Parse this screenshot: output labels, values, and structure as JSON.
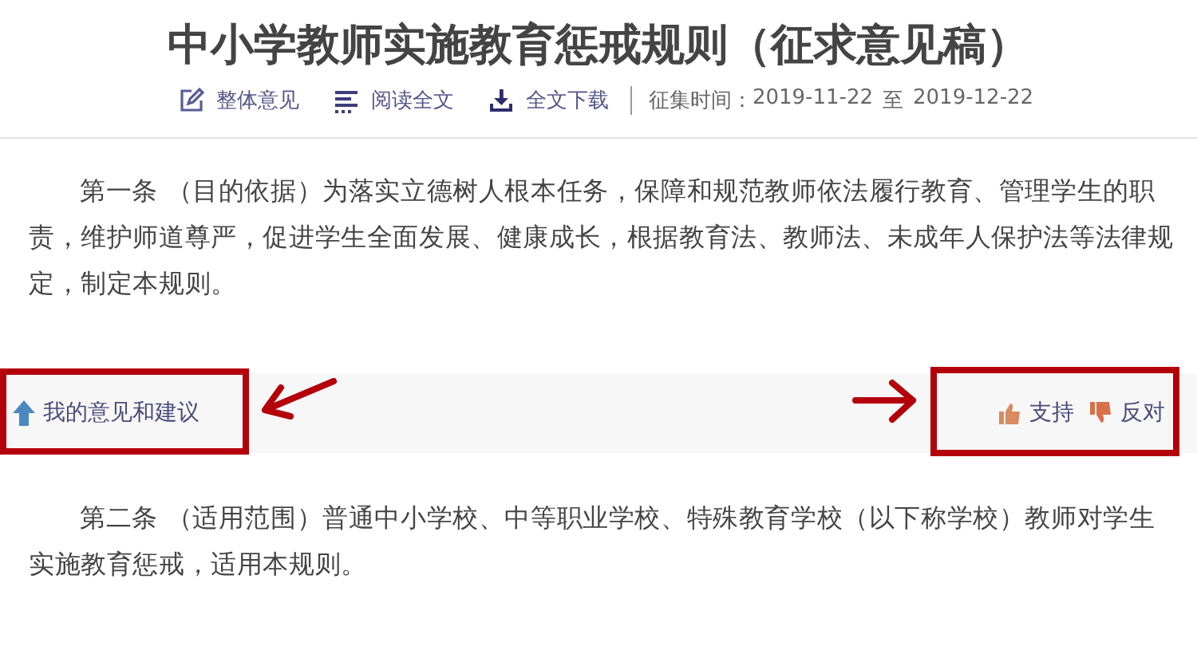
{
  "title": "中小学教师实施教育惩戒规则（征求意见稿）",
  "toolbar": [
    {
      "kind": "edit",
      "label": "整体意见"
    },
    {
      "kind": "read",
      "label": "阅读全文"
    },
    {
      "kind": "download",
      "label": "全文下载"
    }
  ],
  "period": {
    "label": "征集时间：",
    "start": "2019-11-22",
    "separator": "至",
    "end": "2019-12-22"
  },
  "articles": [
    {
      "text": "第一条 （目的依据）为落实立德树人根本任务，保障和规范教师依法履行教育、管理学生的职责，维护师道尊严，促进学生全面发展、健康成长，根据教育法、教师法、未成年人保护法等法律规定，制定本规则。"
    },
    {
      "text": "第二条 （适用范围）普通中小学校、中等职业学校、特殊教育学校（以下称学校）教师对学生实施教育惩戒，适用本规则。"
    }
  ],
  "feedback_bar": {
    "comment_link": "我的意见和建议",
    "votes": [
      {
        "kind": "up",
        "label": "支持"
      },
      {
        "kind": "down",
        "label": "反对"
      }
    ]
  }
}
